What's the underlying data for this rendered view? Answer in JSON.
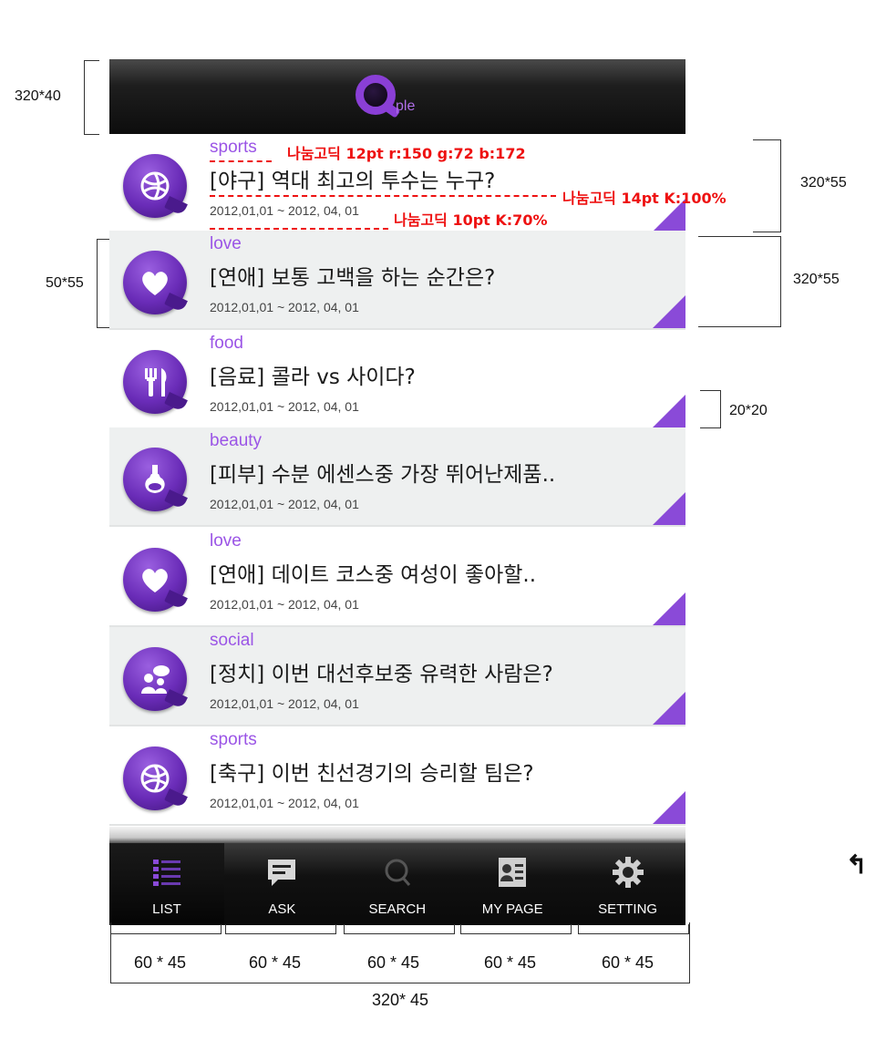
{
  "app": {
    "logo_text": "ple"
  },
  "spec_notes": {
    "header_size": "320*40",
    "row_size_1": "320*55",
    "row_size_2": "320*55",
    "icon_size": "50*55",
    "corner_size": "20*20",
    "category_font": "나눔고딕 12pt  r:150 g:72 b:172",
    "title_font": "나눔고딕 14pt K:100%",
    "date_font": "나눔고딕 10pt K:70%",
    "tab_sizes": [
      "60 * 45",
      "60 * 45",
      "60 * 45",
      "60 * 45",
      "60 * 45"
    ],
    "tabbar_size": "320* 45"
  },
  "list": {
    "items": [
      {
        "category": "sports",
        "icon": "basketball-icon",
        "title": "[야구] 역대 최고의 투수는 누구?",
        "date": "2012,01,01 ~ 2012, 04, 01"
      },
      {
        "category": "love",
        "icon": "heart-icon",
        "title": "[연애] 보통 고백을 하는 순간은?",
        "date": "2012,01,01 ~ 2012, 04, 01"
      },
      {
        "category": "food",
        "icon": "fork-knife-icon",
        "title": "[음료] 콜라 vs 사이다?",
        "date": "2012,01,01 ~ 2012, 04, 01"
      },
      {
        "category": "beauty",
        "icon": "perfume-bottle-icon",
        "title": "[피부] 수분 에센스중 가장 뛰어난제품..",
        "date": "2012,01,01 ~ 2012, 04, 01"
      },
      {
        "category": "love",
        "icon": "heart-icon",
        "title": "[연애] 데이트 코스중 여성이 좋아할..",
        "date": "2012,01,01 ~ 2012, 04, 01"
      },
      {
        "category": "social",
        "icon": "people-chat-icon",
        "title": "[정치] 이번 대선후보중 유력한 사람은?",
        "date": "2012,01,01 ~ 2012, 04, 01"
      },
      {
        "category": "sports",
        "icon": "basketball-icon",
        "title": "[축구] 이번 친선경기의 승리할 팀은?",
        "date": "2012,01,01 ~ 2012, 04, 01"
      }
    ]
  },
  "tabbar": {
    "tabs": [
      {
        "label": "LIST",
        "icon": "list-icon",
        "active": true
      },
      {
        "label": "ASK",
        "icon": "chat-icon",
        "active": false
      },
      {
        "label": "SEARCH",
        "icon": "search-icon",
        "active": false
      },
      {
        "label": "MY PAGE",
        "icon": "profile-card-icon",
        "active": false
      },
      {
        "label": "SETTING",
        "icon": "gear-icon",
        "active": false
      }
    ]
  },
  "colors": {
    "accent": "#9b55e6",
    "annotation_red": "#ee1111"
  }
}
